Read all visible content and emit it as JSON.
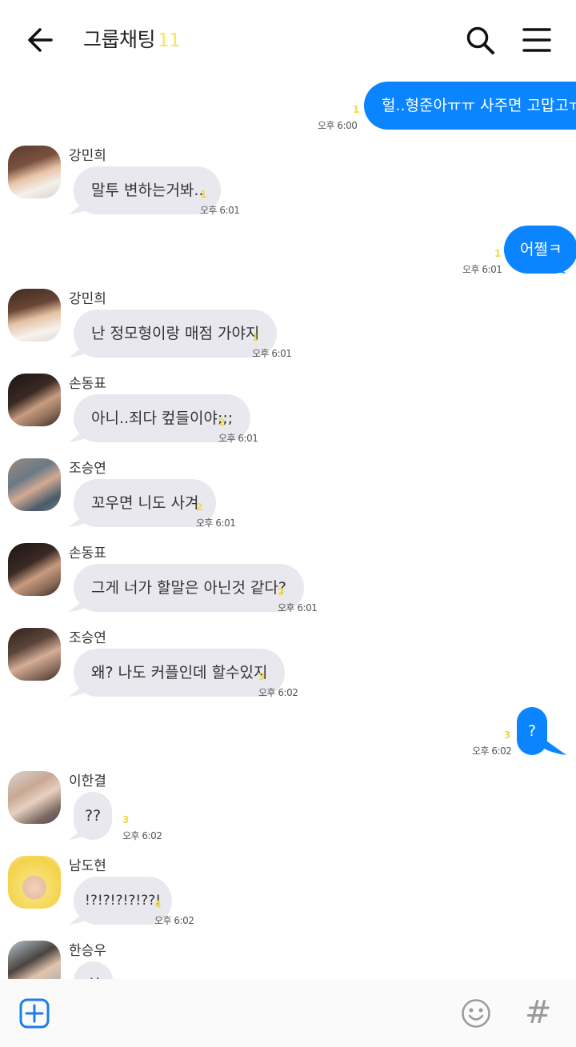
{
  "header": {
    "title": "그룹채팅",
    "member_count": "11"
  },
  "colors": {
    "outgoing_bubble": "#0a84ff",
    "incoming_bubble": "#e9e8ee",
    "unread": "#f0d84a"
  },
  "messages": [
    {
      "direction": "out",
      "text": "헐..형준아ㅠㅠ 사주면 고맙고ㅠ",
      "unread": "1",
      "time": "오후 6:00"
    },
    {
      "direction": "in",
      "sender": "강민희",
      "text": "말투 변하는거봐..",
      "unread": "1",
      "time": "오후 6:01"
    },
    {
      "direction": "out",
      "text": "어쩔ㅋ",
      "unread": "1",
      "time": "오후 6:01"
    },
    {
      "direction": "in",
      "sender": "강민희",
      "text": "난 정모형이랑 매점 가야지",
      "unread": "1",
      "time": "오후 6:01"
    },
    {
      "direction": "in",
      "sender": "손동표",
      "text": "아니..죄다 컾들이야;;;",
      "unread": "2",
      "time": "오후 6:01"
    },
    {
      "direction": "in",
      "sender": "조승연",
      "text": "꼬우면 니도 사겨",
      "unread": "2",
      "time": "오후 6:01"
    },
    {
      "direction": "in",
      "sender": "손동표",
      "text": "그게 너가 할말은 아닌것 같다?",
      "unread": "2",
      "time": "오후 6:01"
    },
    {
      "direction": "in",
      "sender": "조승연",
      "text": "왜? 나도 커플인데 할수있지",
      "unread": "3",
      "time": "오후 6:02"
    },
    {
      "direction": "out",
      "text": "?",
      "unread": "3",
      "time": "오후 6:02"
    },
    {
      "direction": "in",
      "sender": "이한결",
      "text": "??",
      "unread": "3",
      "time": "오후 6:02"
    },
    {
      "direction": "in",
      "sender": "남도현",
      "text": "!?!?!?!?!??!",
      "unread": "4",
      "time": "오후 6:02"
    },
    {
      "direction": "in",
      "sender": "한승우",
      "text": "히",
      "unread": "",
      "time": ""
    }
  ],
  "footer": {
    "plus_icon": "plus-box-icon",
    "emoji_icon": "smiley-icon",
    "hash_label": "#"
  }
}
